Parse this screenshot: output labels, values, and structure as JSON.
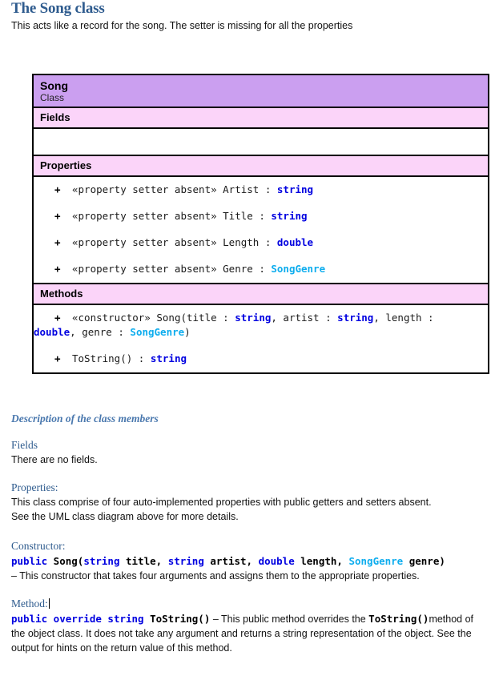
{
  "page": {
    "title": "The Song class",
    "subtitle": "This acts like a record for the song. The setter is missing for all the properties"
  },
  "uml": {
    "class_name": "Song",
    "class_kind": "Class",
    "fields_label": "Fields",
    "fields_rows": [],
    "properties_label": "Properties",
    "properties": [
      {
        "visibility": "+",
        "stereotype": "«property setter absent»",
        "name": "Artist",
        "sep": " : ",
        "type": "string",
        "type_color": "blue"
      },
      {
        "visibility": "+",
        "stereotype": "«property setter absent»",
        "name": "Title",
        "sep": " : ",
        "type": "string",
        "type_color": "blue"
      },
      {
        "visibility": "+",
        "stereotype": "«property setter absent»",
        "name": "Length",
        "sep": " : ",
        "type": "double",
        "type_color": "blue"
      },
      {
        "visibility": "+",
        "stereotype": "«property setter absent»",
        "name": "Genre",
        "sep": " : ",
        "type": "SongGenre",
        "type_color": "cyan"
      }
    ],
    "methods_label": "Methods",
    "constructor": {
      "visibility": "+",
      "stereotype": "«constructor»",
      "signature_open": "Song(title : ",
      "p1_type": "string",
      "p1_tail": ", artist : ",
      "p2_type": "string",
      "p2_tail": ", length : ",
      "p3_type": "double",
      "p3_tail": ", genre : ",
      "p4_type": "SongGenre",
      "signature_close": ")"
    },
    "tostring": {
      "visibility": "+",
      "name": "ToString() : ",
      "type": "string"
    }
  },
  "description": {
    "heading": "Description of the class members",
    "fields": {
      "head": "Fields",
      "body": "There are no fields."
    },
    "properties": {
      "head": "Properties:",
      "line1": "This class comprise of four auto-implemented properties with public getters and setters absent.",
      "line2": "See the UML class diagram above for more details."
    },
    "constructor": {
      "head": "Constructor:",
      "code_kw1": "public",
      "code_name": " Song(",
      "code_t1": "string",
      "code_a1": " title, ",
      "code_t2": "string",
      "code_a2": " artist, ",
      "code_t3": "double",
      "code_a3": " length, ",
      "code_t4": "SongGenre",
      "code_a4": " genre)",
      "note": "– This constructor that takes four arguments and assigns them to the appropriate properties."
    },
    "method": {
      "head": "Method:",
      "code_kw1": "public",
      "code_kw2": " override",
      "code_kw3": " string",
      "code_name": " ToString()",
      "note_a": " – This public method overrides the ",
      "note_code": "ToString()",
      "note_b": "method of the object class. It does not take any argument and returns a string representation of the object. See the output for hints on the return value of this method."
    }
  },
  "colors": {
    "heading_blue": "#2e5b8e",
    "desc_heading_blue": "#4a78ae",
    "uml_header_purple": "#cb9ff0",
    "uml_section_pink": "#fbd4f9",
    "type_blue": "#0000e0",
    "type_cyan": "#0eadee"
  }
}
